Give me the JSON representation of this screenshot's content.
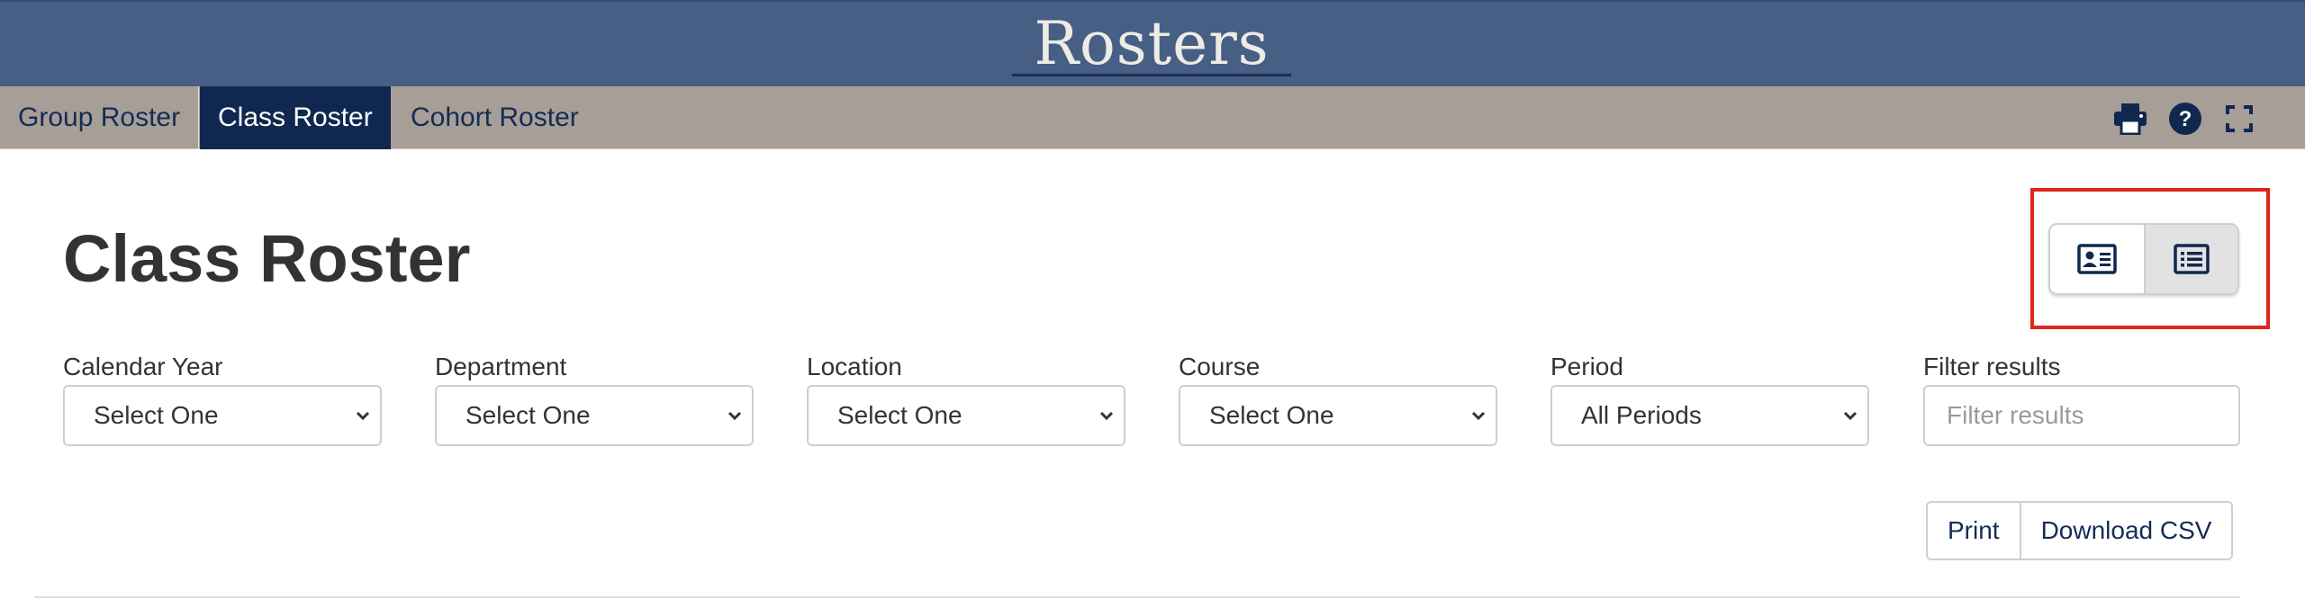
{
  "header": {
    "title": "Rosters"
  },
  "tabs": [
    {
      "label": "Group Roster",
      "active": false
    },
    {
      "label": "Class Roster",
      "active": true
    },
    {
      "label": "Cohort Roster",
      "active": false
    }
  ],
  "toolbar_icons": [
    "print-icon",
    "help-icon",
    "fullscreen-icon"
  ],
  "page": {
    "title": "Class Roster"
  },
  "view_toggle": {
    "options": [
      "card-view-icon",
      "list-view-icon"
    ],
    "active": "list-view-icon"
  },
  "filters": [
    {
      "label": "Calendar Year",
      "value": "Select One"
    },
    {
      "label": "Department",
      "value": "Select One"
    },
    {
      "label": "Location",
      "value": "Select One"
    },
    {
      "label": "Course",
      "value": "Select One"
    },
    {
      "label": "Period",
      "value": "All Periods"
    }
  ],
  "filter_results": {
    "label": "Filter results",
    "placeholder": "Filter results"
  },
  "actions": {
    "print_label": "Print",
    "download_label": "Download CSV"
  },
  "colors": {
    "banner": "#475e85",
    "tab_bar": "#a79e97",
    "tab_active": "#10284f",
    "nav_text": "#142c54",
    "highlight": "#e0251f"
  }
}
